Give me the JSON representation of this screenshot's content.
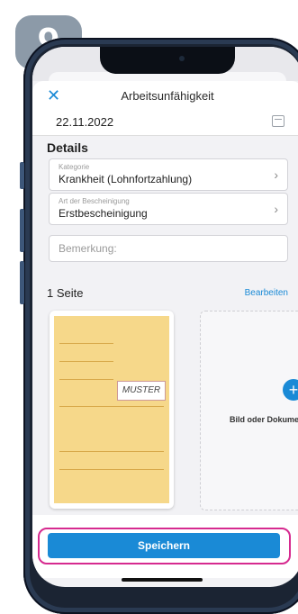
{
  "badge": {
    "number": "9"
  },
  "header": {
    "title": "Arbeitsunfähigkeit",
    "close_icon": "close-icon"
  },
  "date_field": {
    "value": "22.11.2022",
    "icon": "calendar-icon"
  },
  "details": {
    "title": "Details",
    "kategorie": {
      "label": "Kategorie",
      "value": "Krankheit (Lohnfortzahlung)"
    },
    "bescheinigung": {
      "label": "Art der Bescheinigung",
      "value": "Erstbescheinigung"
    },
    "bemerkung": {
      "placeholder": "Bemerkung:"
    }
  },
  "pages": {
    "count_label": "1 Seite",
    "edit_label": "Bearbeiten",
    "document": {
      "stamp": "MUSTER"
    },
    "add_label": "Bild oder Dokument"
  },
  "save": {
    "label": "Speichern"
  },
  "colors": {
    "accent": "#1a8ad6",
    "highlight": "#d62a8f",
    "badge": "#8c9aa8"
  }
}
